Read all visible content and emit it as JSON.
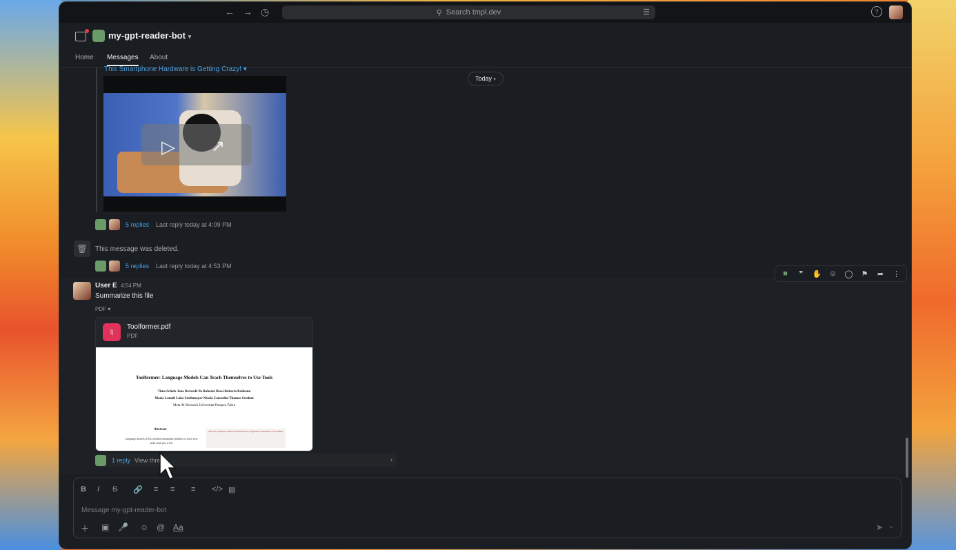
{
  "titlebar": {
    "search_text": "Search tmpl.dev"
  },
  "channel": {
    "name": "my-gpt-reader-bot",
    "tabs": [
      {
        "label": "Home"
      },
      {
        "label": "Messages"
      },
      {
        "label": "About"
      }
    ]
  },
  "messages": {
    "date_divider": "Today",
    "prior_link_title": "This Smartphone Hardware is Getting Crazy!",
    "first_thread": {
      "replies": "5 replies",
      "last_reply": "Last reply today at 4:09 PM"
    },
    "deleted": {
      "text": "This message was deleted."
    },
    "second_thread": {
      "replies": "5 replies",
      "last_reply": "Last reply today at 4:53 PM"
    },
    "user_message": {
      "author": "User E",
      "time": "4:54 PM",
      "text": "Summarize this file",
      "attachment_toggle": "PDF",
      "file": {
        "name": "Toolformer.pdf",
        "type": "PDF",
        "preview_title": "Toolformer: Language Models Can Teach Themselves to Use Tools",
        "preview_authors_1": "Timo Schick   Jane Dwivedi-Yu   Roberto Dessì   Roberta Raileanu",
        "preview_authors_2": "Maria Lomeli   Luke Zettlemoyer   Nicola Cancedda   Thomas Scialom",
        "preview_affil": "Meta AI Research   Universitat Pompeu Fabra",
        "preview_abstract": "Abstract",
        "preview_body": "Language models (LMs) exhibit remarkable abilities to solve new tasks from just a few",
        "preview_box": "The New England Journal of Medicine is a registered trademark of the MMS"
      },
      "thread": {
        "replies": "1 reply",
        "view": "View thread"
      }
    }
  },
  "composer": {
    "placeholder": "Message my-gpt-reader-bot"
  },
  "icons": {
    "back": "arrow-left",
    "forward": "arrow-right",
    "history": "clock",
    "search": "magnifier",
    "pdf": "acrobat"
  },
  "colors": {
    "accent_link": "#4a9fe0",
    "pdf_red": "#e0325a",
    "background": "#1a1d21"
  }
}
